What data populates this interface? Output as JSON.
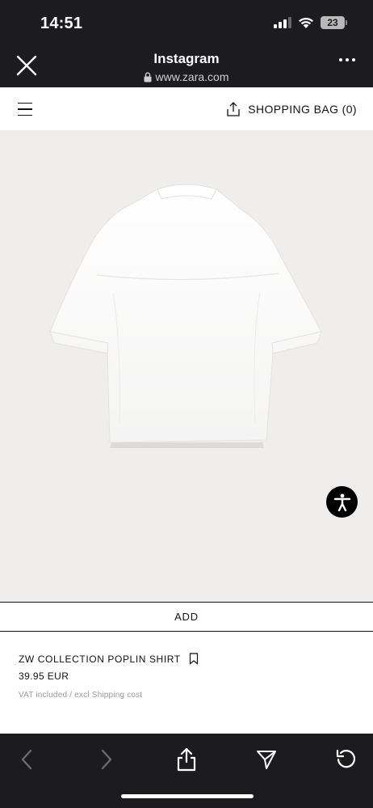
{
  "status_bar": {
    "time": "14:51",
    "battery": "23"
  },
  "header": {
    "title": "Instagram",
    "url": "www.zara.com"
  },
  "nav": {
    "bag_label": "SHOPPING BAG (0)"
  },
  "product": {
    "add_label": "ADD",
    "name": "ZW COLLECTION POPLIN SHIRT",
    "price": "39.95 EUR",
    "vat_note": "VAT included / excl Shipping cost"
  },
  "colors": {
    "dark_bar": "#1c1c1e",
    "image_bg": "#efeeec",
    "text": "#111111"
  }
}
